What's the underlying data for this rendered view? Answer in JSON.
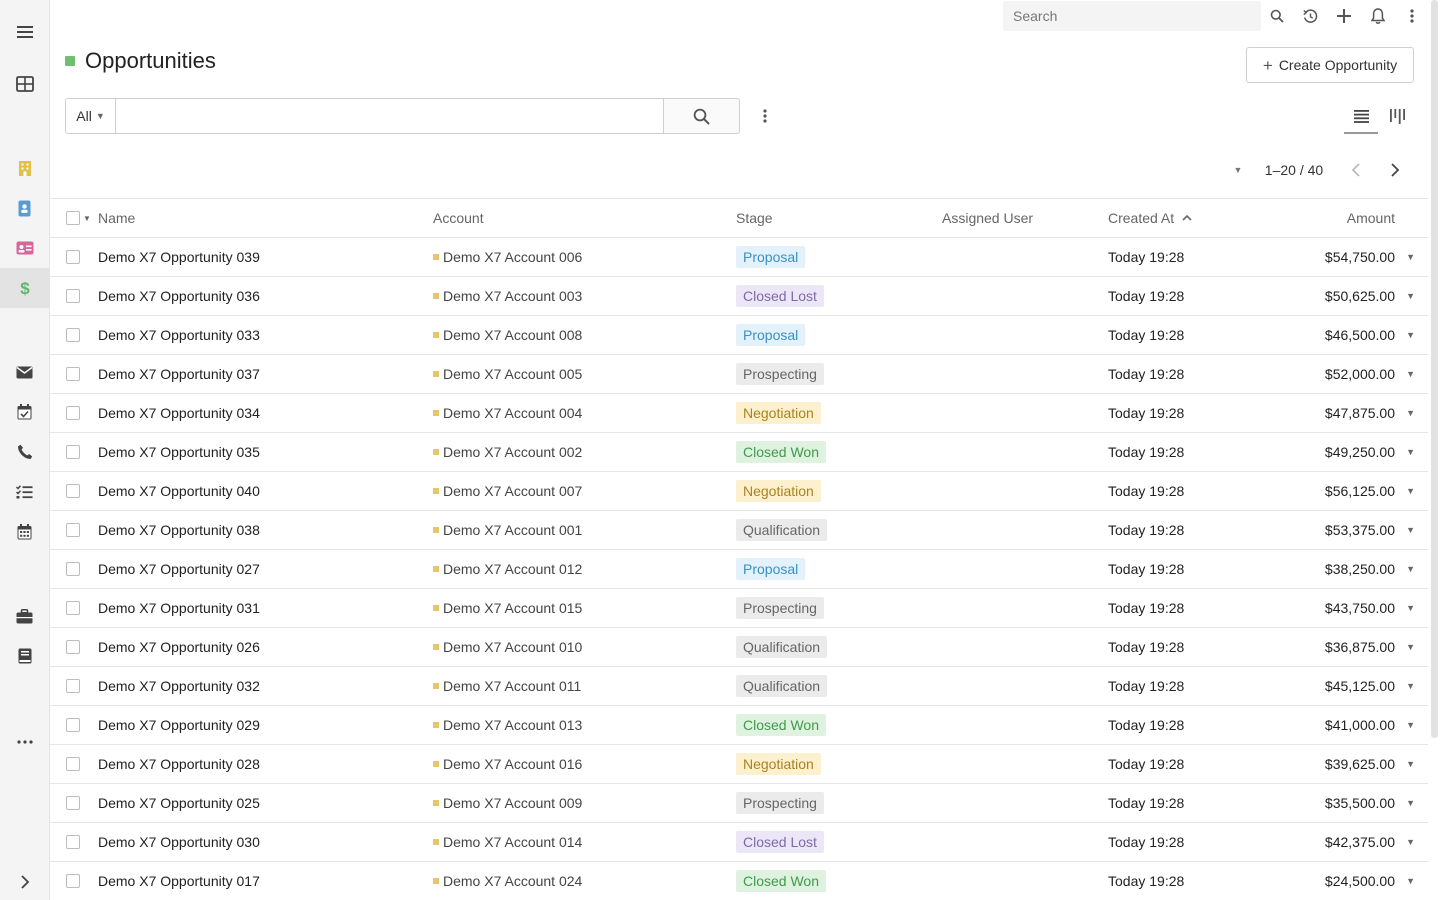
{
  "topbar": {
    "search_placeholder": "Search"
  },
  "header": {
    "title": "Opportunities",
    "title_color": "#6fbf73",
    "create_label": "Create Opportunity"
  },
  "filter": {
    "scope": "All",
    "query": ""
  },
  "pager": {
    "text": "1–20 / 40"
  },
  "columns": {
    "name": "Name",
    "account": "Account",
    "stage": "Stage",
    "assigned_user": "Assigned User",
    "created_at": "Created At",
    "amount": "Amount"
  },
  "stage_colors": {
    "Proposal": {
      "bg": "#e3f1fb",
      "fg": "#3d8fc4"
    },
    "Closed Lost": {
      "bg": "#ece7f6",
      "fg": "#7c6aa8"
    },
    "Prospecting": {
      "bg": "#ebebeb",
      "fg": "#666666"
    },
    "Negotiation": {
      "bg": "#fcf0cf",
      "fg": "#a8841f"
    },
    "Closed Won": {
      "bg": "#dff2e0",
      "fg": "#3f9a4a"
    },
    "Qualification": {
      "bg": "#ebebeb",
      "fg": "#666666"
    }
  },
  "rows": [
    {
      "name": "Demo X7 Opportunity 039",
      "account": "Demo X7 Account 006",
      "stage": "Proposal",
      "assigned_user": "",
      "created_at": "Today 19:28",
      "amount": "$54,750.00"
    },
    {
      "name": "Demo X7 Opportunity 036",
      "account": "Demo X7 Account 003",
      "stage": "Closed Lost",
      "assigned_user": "",
      "created_at": "Today 19:28",
      "amount": "$50,625.00"
    },
    {
      "name": "Demo X7 Opportunity 033",
      "account": "Demo X7 Account 008",
      "stage": "Proposal",
      "assigned_user": "",
      "created_at": "Today 19:28",
      "amount": "$46,500.00"
    },
    {
      "name": "Demo X7 Opportunity 037",
      "account": "Demo X7 Account 005",
      "stage": "Prospecting",
      "assigned_user": "",
      "created_at": "Today 19:28",
      "amount": "$52,000.00"
    },
    {
      "name": "Demo X7 Opportunity 034",
      "account": "Demo X7 Account 004",
      "stage": "Negotiation",
      "assigned_user": "",
      "created_at": "Today 19:28",
      "amount": "$47,875.00"
    },
    {
      "name": "Demo X7 Opportunity 035",
      "account": "Demo X7 Account 002",
      "stage": "Closed Won",
      "assigned_user": "",
      "created_at": "Today 19:28",
      "amount": "$49,250.00"
    },
    {
      "name": "Demo X7 Opportunity 040",
      "account": "Demo X7 Account 007",
      "stage": "Negotiation",
      "assigned_user": "",
      "created_at": "Today 19:28",
      "amount": "$56,125.00"
    },
    {
      "name": "Demo X7 Opportunity 038",
      "account": "Demo X7 Account 001",
      "stage": "Qualification",
      "assigned_user": "",
      "created_at": "Today 19:28",
      "amount": "$53,375.00"
    },
    {
      "name": "Demo X7 Opportunity 027",
      "account": "Demo X7 Account 012",
      "stage": "Proposal",
      "assigned_user": "",
      "created_at": "Today 19:28",
      "amount": "$38,250.00"
    },
    {
      "name": "Demo X7 Opportunity 031",
      "account": "Demo X7 Account 015",
      "stage": "Prospecting",
      "assigned_user": "",
      "created_at": "Today 19:28",
      "amount": "$43,750.00"
    },
    {
      "name": "Demo X7 Opportunity 026",
      "account": "Demo X7 Account 010",
      "stage": "Qualification",
      "assigned_user": "",
      "created_at": "Today 19:28",
      "amount": "$36,875.00"
    },
    {
      "name": "Demo X7 Opportunity 032",
      "account": "Demo X7 Account 011",
      "stage": "Qualification",
      "assigned_user": "",
      "created_at": "Today 19:28",
      "amount": "$45,125.00"
    },
    {
      "name": "Demo X7 Opportunity 029",
      "account": "Demo X7 Account 013",
      "stage": "Closed Won",
      "assigned_user": "",
      "created_at": "Today 19:28",
      "amount": "$41,000.00"
    },
    {
      "name": "Demo X7 Opportunity 028",
      "account": "Demo X7 Account 016",
      "stage": "Negotiation",
      "assigned_user": "",
      "created_at": "Today 19:28",
      "amount": "$39,625.00"
    },
    {
      "name": "Demo X7 Opportunity 025",
      "account": "Demo X7 Account 009",
      "stage": "Prospecting",
      "assigned_user": "",
      "created_at": "Today 19:28",
      "amount": "$35,500.00"
    },
    {
      "name": "Demo X7 Opportunity 030",
      "account": "Demo X7 Account 014",
      "stage": "Closed Lost",
      "assigned_user": "",
      "created_at": "Today 19:28",
      "amount": "$42,375.00"
    },
    {
      "name": "Demo X7 Opportunity 017",
      "account": "Demo X7 Account 024",
      "stage": "Closed Won",
      "assigned_user": "",
      "created_at": "Today 19:28",
      "amount": "$24,500.00"
    }
  ],
  "sidebar": {
    "items": [
      {
        "icon": "menu-icon"
      },
      {
        "icon": "grid-icon"
      },
      {
        "icon": "building-icon",
        "color": "#e2c04a"
      },
      {
        "icon": "contact-book-icon",
        "color": "#5b9bd5"
      },
      {
        "icon": "id-card-icon",
        "color": "#d9669b"
      },
      {
        "icon": "dollar-icon",
        "color": "#5fb868"
      },
      {
        "icon": "envelope-icon"
      },
      {
        "icon": "calendar-check-icon"
      },
      {
        "icon": "phone-icon"
      },
      {
        "icon": "tasks-icon"
      },
      {
        "icon": "calendar-icon"
      },
      {
        "icon": "briefcase-icon"
      },
      {
        "icon": "book-icon"
      },
      {
        "icon": "more-icon"
      },
      {
        "icon": "chevron-right-icon"
      }
    ]
  }
}
